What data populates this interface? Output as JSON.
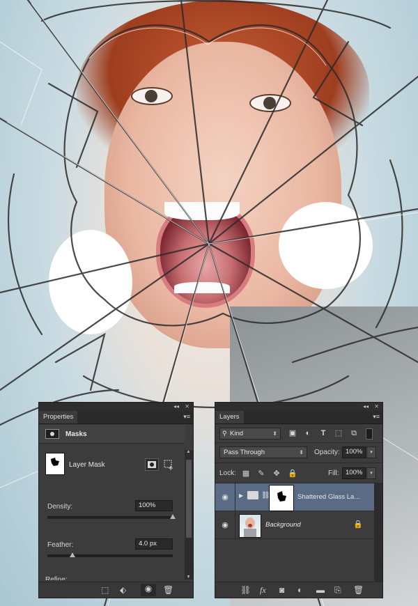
{
  "canvas": {
    "subject": "screaming woman behind shattered glass"
  },
  "properties_panel": {
    "tab": "Properties",
    "section": "Masks",
    "mask_label": "Layer Mask",
    "density_label": "Density:",
    "density_value": "100%",
    "density_percent": 100,
    "feather_label": "Feather:",
    "feather_value": "4.0 px",
    "feather_percent": 0.2,
    "refine_label": "Refine:"
  },
  "layers_panel": {
    "tab": "Layers",
    "filter_kind": "Kind",
    "blend_mode": "Pass Through",
    "opacity_label": "Opacity:",
    "opacity_value": "100%",
    "lock_label": "Lock:",
    "fill_label": "Fill:",
    "fill_value": "100%",
    "layers": [
      {
        "name": "Shattered Glass La...",
        "type": "group",
        "selected": true
      },
      {
        "name": "Background",
        "type": "image",
        "locked": true
      }
    ],
    "bottom_icons": [
      "link-icon",
      "fx-icon",
      "add-mask-icon",
      "adjustment-icon",
      "new-group-icon",
      "new-layer-icon",
      "trash-icon"
    ]
  },
  "colors": {
    "panel_bg": "#3c3c3c",
    "selected_row": "#5a6b86",
    "dark_field": "#2a2a2a"
  }
}
